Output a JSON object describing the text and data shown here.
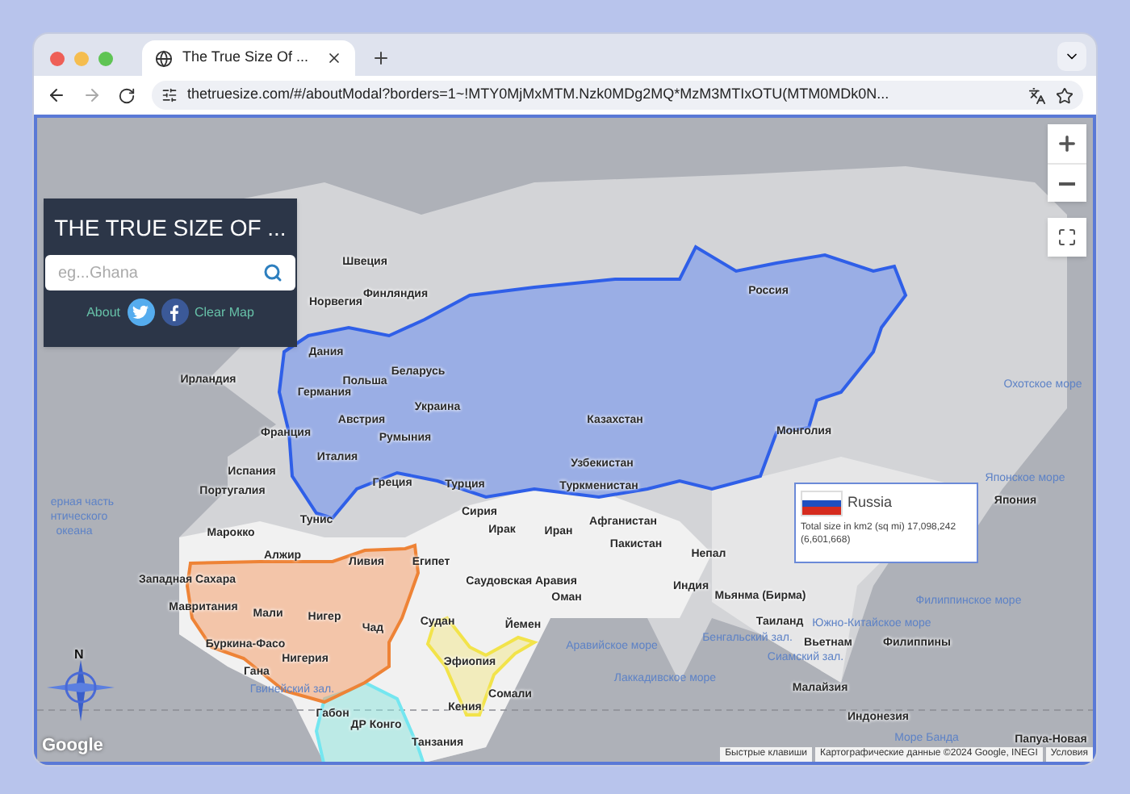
{
  "browser": {
    "tab_title": "The True Size Of ...",
    "url": "thetruesize.com/#/aboutModal?borders=1~!MTY0MjMxMTM.Nzk0MDg2MQ*MzM3MTIxOTU(MTM0MDk0N..."
  },
  "search_panel": {
    "title": "THE TRUE SIZE OF ...",
    "placeholder": "eg...Ghana",
    "about": "About",
    "clear": "Clear Map"
  },
  "map": {
    "labels": [
      {
        "text": "Швеция",
        "kind": "country"
      },
      {
        "text": "Финляндия",
        "kind": "country"
      },
      {
        "text": "Норвегия",
        "kind": "country"
      },
      {
        "text": "Дания",
        "kind": "country"
      },
      {
        "text": "Ирландия",
        "kind": "country"
      },
      {
        "text": "Беларусь",
        "kind": "country"
      },
      {
        "text": "Польша",
        "kind": "country"
      },
      {
        "text": "Германия",
        "kind": "country"
      },
      {
        "text": "Украина",
        "kind": "country"
      },
      {
        "text": "Австрия",
        "kind": "country"
      },
      {
        "text": "Франция",
        "kind": "country"
      },
      {
        "text": "Румыния",
        "kind": "country"
      },
      {
        "text": "Италия",
        "kind": "country"
      },
      {
        "text": "Испания",
        "kind": "country"
      },
      {
        "text": "Греция",
        "kind": "country"
      },
      {
        "text": "Турция",
        "kind": "country"
      },
      {
        "text": "Португалия",
        "kind": "country"
      },
      {
        "text": "Тунис",
        "kind": "country"
      },
      {
        "text": "Марокко",
        "kind": "country"
      },
      {
        "text": "Алжир",
        "kind": "country"
      },
      {
        "text": "Ливия",
        "kind": "country"
      },
      {
        "text": "Египет",
        "kind": "country"
      },
      {
        "text": "Сирия",
        "kind": "country"
      },
      {
        "text": "Ирак",
        "kind": "country"
      },
      {
        "text": "Иран",
        "kind": "country"
      },
      {
        "text": "Западная Сахара",
        "kind": "country"
      },
      {
        "text": "Саудовская Аравия",
        "kind": "country"
      },
      {
        "text": "Мавритания",
        "kind": "country"
      },
      {
        "text": "Мали",
        "kind": "country"
      },
      {
        "text": "Нигер",
        "kind": "country"
      },
      {
        "text": "Чад",
        "kind": "country"
      },
      {
        "text": "Судан",
        "kind": "country"
      },
      {
        "text": "Йемен",
        "kind": "country"
      },
      {
        "text": "Буркина-Фасо",
        "kind": "country"
      },
      {
        "text": "Нигерия",
        "kind": "country"
      },
      {
        "text": "Эфиопия",
        "kind": "country"
      },
      {
        "text": "Гана",
        "kind": "country"
      },
      {
        "text": "Сомали",
        "kind": "country"
      },
      {
        "text": "Кения",
        "kind": "country"
      },
      {
        "text": "Габон",
        "kind": "country"
      },
      {
        "text": "ДР Конго",
        "kind": "country"
      },
      {
        "text": "Танзания",
        "kind": "country"
      },
      {
        "text": "Россия",
        "kind": "country"
      },
      {
        "text": "Казахстан",
        "kind": "country"
      },
      {
        "text": "Монголия",
        "kind": "country"
      },
      {
        "text": "Узбекистан",
        "kind": "country"
      },
      {
        "text": "Туркменистан",
        "kind": "country"
      },
      {
        "text": "Афганистан",
        "kind": "country"
      },
      {
        "text": "Пакистан",
        "kind": "country"
      },
      {
        "text": "Непал",
        "kind": "country"
      },
      {
        "text": "Индия",
        "kind": "country"
      },
      {
        "text": "Оман",
        "kind": "country"
      },
      {
        "text": "Мьянма (Бирма)",
        "kind": "country"
      },
      {
        "text": "Таиланд",
        "kind": "country"
      },
      {
        "text": "Вьетнам",
        "kind": "country"
      },
      {
        "text": "Филиппины",
        "kind": "country"
      },
      {
        "text": "Малайзия",
        "kind": "country"
      },
      {
        "text": "Индонезия",
        "kind": "country"
      },
      {
        "text": "Япония",
        "kind": "country"
      },
      {
        "text": "Папуа-Новая",
        "kind": "country"
      },
      {
        "text": "ерная часть",
        "kind": "water"
      },
      {
        "text": "нтического",
        "kind": "water"
      },
      {
        "text": "океана",
        "kind": "water"
      },
      {
        "text": "Охотское море",
        "kind": "water"
      },
      {
        "text": "Японское море",
        "kind": "water"
      },
      {
        "text": "Филиппинское море",
        "kind": "water"
      },
      {
        "text": "Южно-Китайское море",
        "kind": "water"
      },
      {
        "text": "Бенгальский зал.",
        "kind": "water"
      },
      {
        "text": "Аравийское море",
        "kind": "water"
      },
      {
        "text": "Сиамский зал.",
        "kind": "water"
      },
      {
        "text": "Лаккадивское море",
        "kind": "water"
      },
      {
        "text": "Гвинейский зал.",
        "kind": "water"
      },
      {
        "text": "Море Банда",
        "kind": "water"
      }
    ],
    "info": {
      "country": "Russia",
      "size_text": "Total size in km2 (sq mi) 17,098,242 (6,601,668)"
    },
    "compass": "N",
    "logo": "Google",
    "attribution": [
      "Быстрые клавиши",
      "Картографические данные ©2024 Google, INEGI",
      "Условия"
    ]
  }
}
